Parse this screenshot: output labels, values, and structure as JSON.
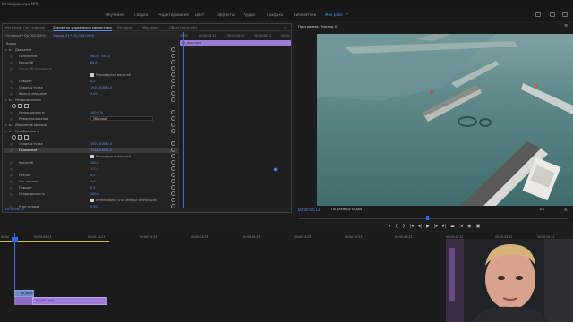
{
  "window": {
    "document_title": "Сплайдерыпро МП5"
  },
  "workspace": {
    "tabs": [
      "Обучение",
      "Сборка",
      "Редактирование",
      "Цвет",
      "Эффекты",
      "Аудио",
      "Графика",
      "Библиотеки",
      "Мое рабо"
    ],
    "active_index": 8
  },
  "effect_controls": {
    "tabs": [
      "Источник: (нет клипов)",
      "Элементы управления эффектами",
      "История",
      "Маркеры",
      "Области Lumetri"
    ],
    "active_index": 1,
    "clip_path": "Основной * DJI_0001.MOV",
    "sequence_path": "Эпизод 01 * DJI_0001.MOV",
    "section_video": "Видео",
    "rows": [
      {
        "kind": "header",
        "label": "Движение"
      },
      {
        "kind": "param",
        "label": "Положение",
        "value": "960,0   540,0"
      },
      {
        "kind": "param",
        "label": "Масштаб",
        "value": "68,0"
      },
      {
        "kind": "param-dim",
        "label": "Масштаб по ширине",
        "value": ""
      },
      {
        "kind": "check",
        "label": "",
        "check_label": "Равномерный масштаб"
      },
      {
        "kind": "param",
        "label": "Поворот",
        "value": "0,0"
      },
      {
        "kind": "param",
        "label": "Опорная точка",
        "value": "1920,0   1080,0"
      },
      {
        "kind": "param",
        "label": "Фильтр мерцания",
        "value": "0,00"
      },
      {
        "kind": "header",
        "label": "Непрозрачность"
      },
      {
        "kind": "shapes",
        "label": ""
      },
      {
        "kind": "param",
        "label": "Непрозрачность",
        "value": "100,0 %"
      },
      {
        "kind": "dropdown",
        "label": "Режим наложения",
        "value": "Обычный"
      },
      {
        "kind": "header",
        "label": "Изменение времени"
      },
      {
        "kind": "header",
        "label": "Преобразовать"
      },
      {
        "kind": "shapes",
        "label": ""
      },
      {
        "kind": "param",
        "label": "Опорная точка",
        "value": "1920,0   1080,0"
      },
      {
        "kind": "param-hl",
        "label": "Положение",
        "value": "1964,0   1080,0"
      },
      {
        "kind": "check",
        "label": "",
        "check_label": "Равномерный масштаб"
      },
      {
        "kind": "param",
        "label": "Масштаб",
        "value": "100,0"
      },
      {
        "kind": "param-dim",
        "label": "",
        "value": "100,0"
      },
      {
        "kind": "param",
        "label": "Наклон",
        "value": "0,0"
      },
      {
        "kind": "param",
        "label": "Ось наклона",
        "value": "0,0"
      },
      {
        "kind": "param",
        "label": "Поворот",
        "value": "0,0"
      },
      {
        "kind": "param",
        "label": "Непрозрачность",
        "value": "100,0"
      },
      {
        "kind": "check",
        "label": "",
        "check_label": "Использовать угол затвора композиции"
      },
      {
        "kind": "param",
        "label": "Угол затвора",
        "value": "0,00"
      }
    ],
    "footer_timecode": "00:00:06:13",
    "mini_timeline": {
      "ruler": [
        "00:00",
        "00:00:07:12",
        "00:00:08:00",
        "00:00:08:12",
        "00:00:"
      ],
      "clip_label": "DJI_0001.MOV"
    }
  },
  "program": {
    "title": "Программа: Эпизод 01",
    "timecode": "00:00:06:13",
    "fit": "По размеру кадра",
    "resolution": "1/4",
    "transport": [
      "marker-icon",
      "mark-in-icon",
      "mark-out-icon",
      "go-to-in-icon",
      "step-back-icon",
      "play-icon",
      "step-forward-icon",
      "go-to-out-icon",
      "lift-icon",
      "extract-icon",
      "export-frame-icon",
      "compare-icon"
    ],
    "transport_glyphs": [
      "▾",
      "{",
      "}",
      "|◂",
      "◂|",
      "▶",
      "|▸",
      "▸|",
      "⏏",
      "⇲",
      "◉",
      "▣"
    ]
  },
  "timeline": {
    "ruler": [
      "00:00",
      "00:00:04:23",
      "00:00:14:23",
      "00:00:19:23",
      "00:00:24:23",
      "00:00:29:23",
      "00:00:34:23",
      "00:00:39:23",
      "00:00:44:22",
      "00:00:49:22",
      "00:00:54:22",
      "00:00:59:22"
    ],
    "video_clip_label": "DJI_0001.MOV",
    "audio_clip_label": "DJI_0001.MOV"
  },
  "colors": {
    "accent": "#4f8cff",
    "playhead": "#2a6cff",
    "audio_clip": "#a17dd9",
    "video_clip": "#6f86c9"
  }
}
